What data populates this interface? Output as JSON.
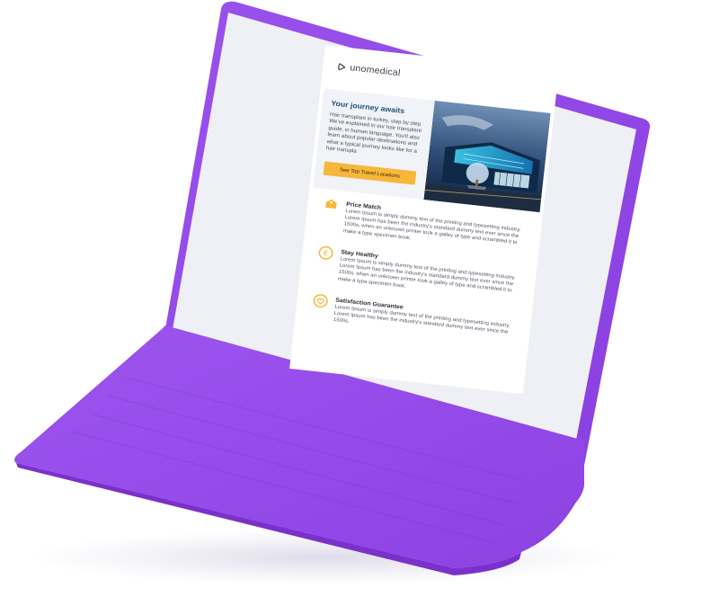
{
  "brand": {
    "logo_text": "unomedical"
  },
  "hero": {
    "title": "Your journey awaits",
    "text": "Hair transplant in turkey, step by step. We've explained in our hair transplant guide, in human language. You'll also learn about popular destinations and what a typical journey looks like for a hair transpla",
    "cta_label": "See Top Travel Locations"
  },
  "features": [
    {
      "icon": "price-tag-icon",
      "title": "Price Match",
      "text": "Lorem Ipsum is simply dummy text of the printing and typesetting industry. Lorem Ipsum has been the industry's standard dummy text ever since the 1500s, when an unknown printer took a galley of type and scrambled it to make a type specimen book."
    },
    {
      "icon": "euro-icon",
      "title": "Stay Healthy",
      "text": "Lorem Ipsum is simply dummy text of the printing and typesetting industry. Lorem Ipsum has been the industry's standard dummy text ever since the 1500s, when an unknown printer took a galley of type and scrambled it to make a type specimen book."
    },
    {
      "icon": "shield-heart-icon",
      "title": "Satisfaction Guarantee",
      "text": "Lorem Ipsum is simply dummy text of the printing and typesetting industry. Lorem Ipsum has been the industry's standard dummy text ever since the 1500s."
    }
  ],
  "colors": {
    "laptop_body": "#9249e3",
    "laptop_keyboard": "#8a3fdb",
    "screen_background": "#eef0f5",
    "accent_yellow": "#f6b73c",
    "heading_blue": "#1f4e79"
  }
}
